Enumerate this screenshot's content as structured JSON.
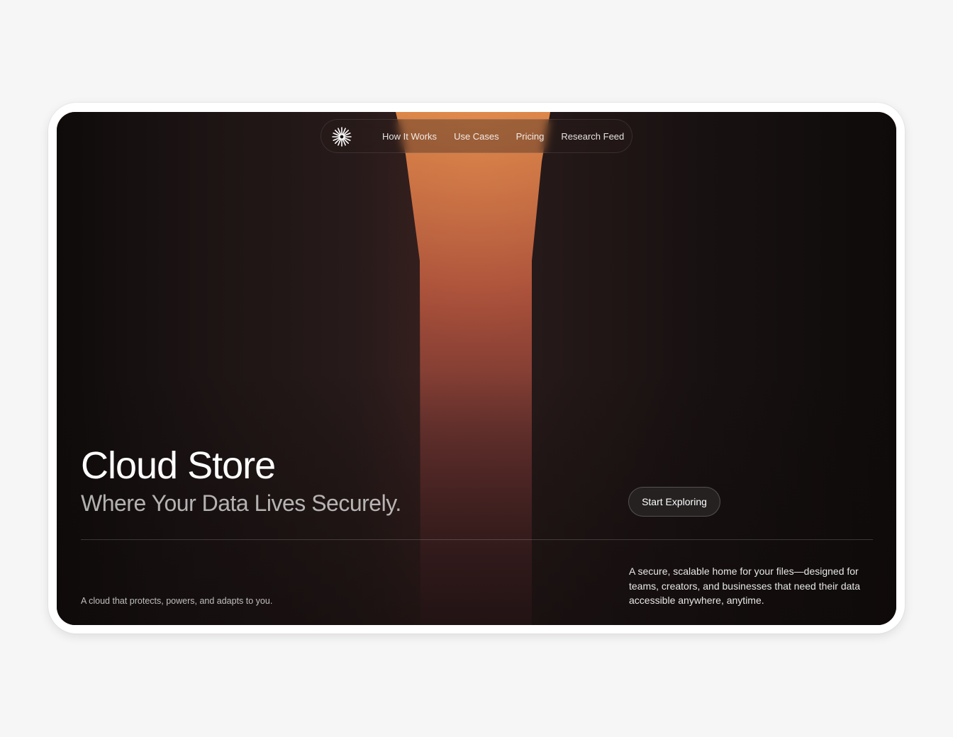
{
  "nav": {
    "logo_icon": "asterisk-burst-icon",
    "links": [
      {
        "label": "How It Works"
      },
      {
        "label": "Use Cases"
      },
      {
        "label": "Pricing"
      },
      {
        "label": "Research Feed"
      }
    ]
  },
  "hero": {
    "title": "Cloud Store",
    "subtitle": "Where Your Data Lives Securely.",
    "cta_label": "Start Exploring",
    "tagline": "A cloud that protects, powers, and adapts to you.",
    "description": "A secure, scalable home for your files—designed for teams, creators, and businesses that need their data accessible anywhere, anytime."
  },
  "colors": {
    "page_background": "#f6f6f6",
    "hero_dark": "#141010",
    "glow_orange": "#d98347",
    "glow_deep": "#4a2526",
    "text_primary": "#ffffff"
  }
}
